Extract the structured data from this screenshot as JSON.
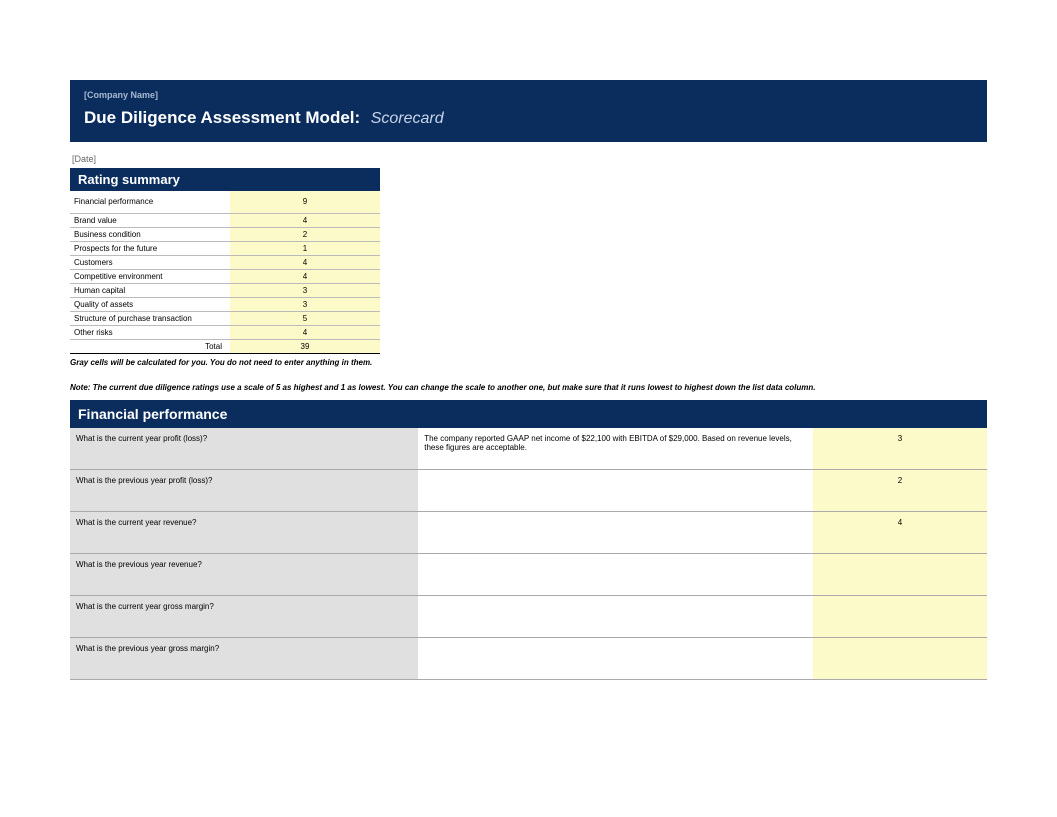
{
  "header": {
    "company": "[Company Name]",
    "title": "Due Diligence Assessment Model:",
    "subtitle": "Scorecard"
  },
  "date": "[Date]",
  "rating_summary": {
    "title": "Rating summary",
    "rows": [
      {
        "label": "Financial performance",
        "value": "9"
      },
      {
        "label": "Brand value",
        "value": "4"
      },
      {
        "label": "Business condition",
        "value": "2"
      },
      {
        "label": "Prospects for the future",
        "value": "1"
      },
      {
        "label": "Customers",
        "value": "4"
      },
      {
        "label": "Competitive environment",
        "value": "4"
      },
      {
        "label": "Human capital",
        "value": "3"
      },
      {
        "label": "Quality of assets",
        "value": "3"
      },
      {
        "label": "Structure of purchase transaction",
        "value": "5"
      },
      {
        "label": "Other risks",
        "value": "4"
      }
    ],
    "total_label": "Total",
    "total_value": "39"
  },
  "gray_note": "Gray cells will be calculated for you. You do not need to enter anything in them.",
  "scale_note": "Note: The current due diligence ratings use a scale of 5 as highest and 1 as lowest. You can change the scale to another one, but make sure that it runs lowest to highest down the list data column.",
  "fp": {
    "title": "Financial performance",
    "rows": [
      {
        "q": "What is the current year profit (loss)?",
        "a": "The company reported GAAP net income of $22,100 with EBITDA of $29,000. Based on revenue levels, these figures are acceptable.",
        "r": "3"
      },
      {
        "q": "What is the previous year profit (loss)?",
        "a": "",
        "r": "2"
      },
      {
        "q": "What is the current year revenue?",
        "a": "",
        "r": "4"
      },
      {
        "q": "What is the previous year revenue?",
        "a": "",
        "r": ""
      },
      {
        "q": "What is the current year gross margin?",
        "a": "",
        "r": ""
      },
      {
        "q": "What is the previous year gross margin?",
        "a": "",
        "r": ""
      }
    ]
  }
}
